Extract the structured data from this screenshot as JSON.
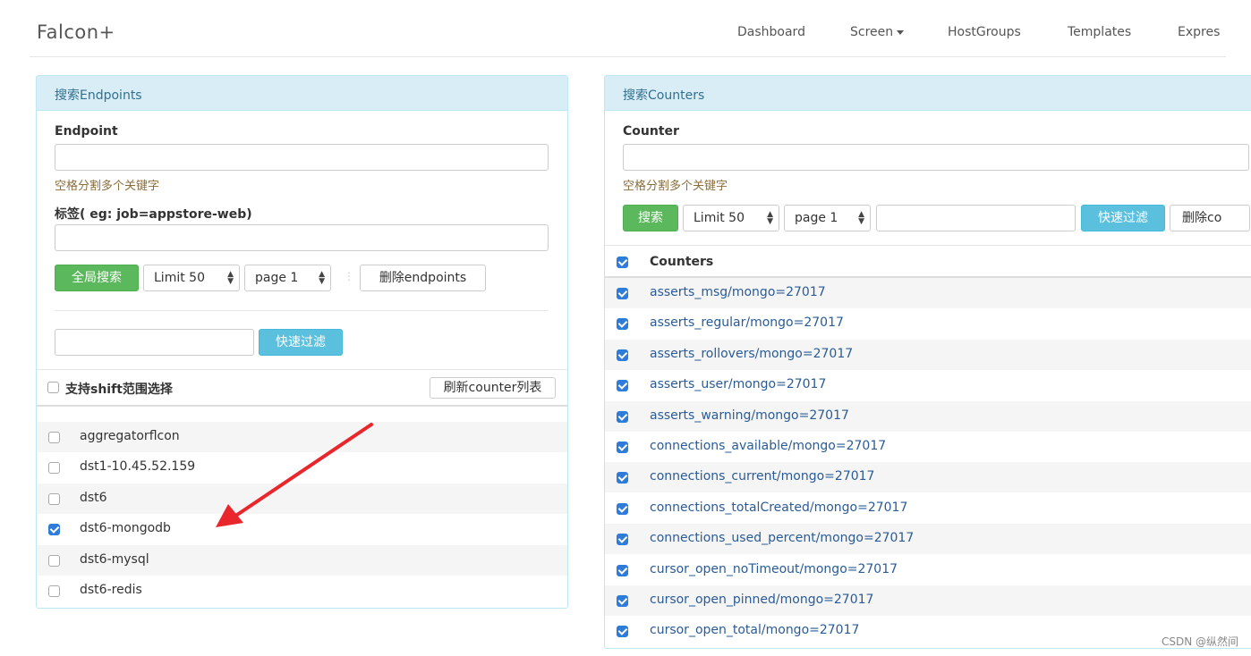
{
  "navbar": {
    "brand": "Falcon+",
    "links": [
      "Dashboard",
      "Screen",
      "HostGroups",
      "Templates",
      "Expres"
    ]
  },
  "left_panel": {
    "title": "搜索Endpoints",
    "endpoint_label": "Endpoint",
    "help_text": "空格分割多个关键字",
    "tag_label": "标签( eg: job=appstore-web)",
    "search_button": "全局搜索",
    "limit_select": "Limit 50",
    "page_select": "page 1",
    "delete_button": "删除endpoints",
    "filter_button": "快速过滤",
    "shift_label": "支持shift范围选择",
    "refresh_button": "刷新counter列表",
    "endpoints": [
      {
        "name": "aggregatorflcon",
        "checked": false
      },
      {
        "name": "dst1-10.45.52.159",
        "checked": false
      },
      {
        "name": "dst6",
        "checked": false
      },
      {
        "name": "dst6-mongodb",
        "checked": true
      },
      {
        "name": "dst6-mysql",
        "checked": false
      },
      {
        "name": "dst6-redis",
        "checked": false
      }
    ]
  },
  "right_panel": {
    "title": "搜索Counters",
    "counter_label": "Counter",
    "help_text": "空格分割多个关键字",
    "search_button": "搜索",
    "limit_select": "Limit 50",
    "page_select": "page 1",
    "filter_button": "快速过滤",
    "delete_button": "删除co",
    "header": "Counters",
    "counters": [
      "asserts_msg/mongo=27017",
      "asserts_regular/mongo=27017",
      "asserts_rollovers/mongo=27017",
      "asserts_user/mongo=27017",
      "asserts_warning/mongo=27017",
      "connections_available/mongo=27017",
      "connections_current/mongo=27017",
      "connections_totalCreated/mongo=27017",
      "connections_used_percent/mongo=27017",
      "cursor_open_noTimeout/mongo=27017",
      "cursor_open_pinned/mongo=27017",
      "cursor_open_total/mongo=27017"
    ]
  },
  "watermark": "CSDN @纵然间",
  "colors": {
    "accent_success": "#5cb85c",
    "accent_info": "#5bc0de",
    "panel_heading": "#d9edf7",
    "checkbox_checked": "#2f7bd9",
    "arrow": "#e8262b"
  }
}
